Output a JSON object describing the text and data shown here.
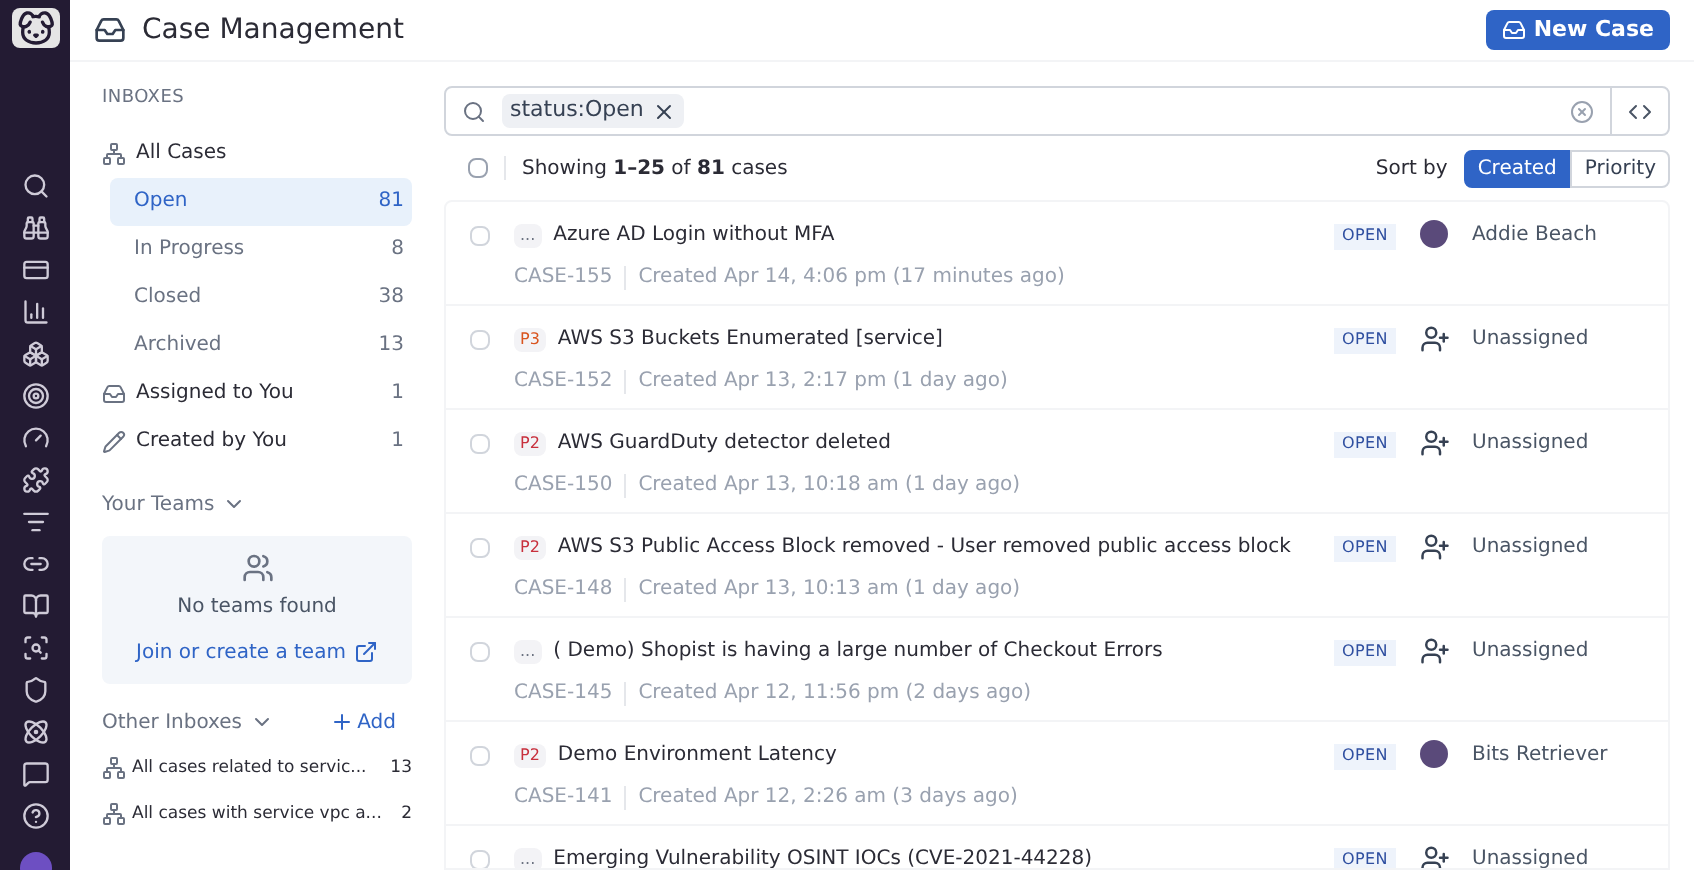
{
  "header": {
    "title": "Case Management",
    "new_button": "New Case"
  },
  "sidebar": {
    "inboxes_heading": "INBOXES",
    "items": [
      {
        "label": "All Cases",
        "kind": "cases",
        "selected": false,
        "children": [
          {
            "label": "Open",
            "count": "81",
            "selected": true
          },
          {
            "label": "In Progress",
            "count": "8",
            "selected": false
          },
          {
            "label": "Closed",
            "count": "38",
            "selected": false
          },
          {
            "label": "Archived",
            "count": "13",
            "selected": false
          }
        ]
      },
      {
        "label": "Assigned to You",
        "kind": "inbox",
        "count": "1",
        "selected": false
      },
      {
        "label": "Created by You",
        "kind": "pencil",
        "count": "1",
        "selected": false
      }
    ],
    "teams_heading": "Your Teams",
    "teams_empty": "No teams found",
    "teams_link": "Join or create a team",
    "other_heading": "Other Inboxes",
    "add_label": "Add",
    "other_items": [
      {
        "label": "All cases related to servic...",
        "count": "13"
      },
      {
        "label": "All cases with service vpc a...",
        "count": "2"
      }
    ]
  },
  "search": {
    "tag": "status:Open"
  },
  "list_header": {
    "select_all_checked": false,
    "showing": "Showing **1–25** of **81** cases",
    "sort_label": "Sort by",
    "sort_options": [
      {
        "label": "Created",
        "selected": true
      },
      {
        "label": "Priority",
        "selected": false
      }
    ]
  },
  "cases": [
    {
      "checked": false,
      "priority": {
        "label": "...",
        "color": "#6b7280"
      },
      "title": "Azure AD Login without MFA",
      "id": "CASE-155",
      "created": "Created Apr 14, 4:06 pm (17 minutes ago)",
      "status": "OPEN",
      "assignee": "Addie Beach",
      "kind": "assigned"
    },
    {
      "checked": false,
      "priority": {
        "label": "P3",
        "color": "#d9541e"
      },
      "title": "AWS S3 Buckets Enumerated [service]",
      "id": "CASE-152",
      "created": "Created Apr 13, 2:17 pm (1 day ago)",
      "status": "OPEN",
      "assignee": "Unassigned",
      "kind": "unassigned"
    },
    {
      "checked": false,
      "priority": {
        "label": "P2",
        "color": "#c8303d"
      },
      "title": "AWS GuardDuty detector deleted",
      "id": "CASE-150",
      "created": "Created Apr 13, 10:18 am (1 day ago)",
      "status": "OPEN",
      "assignee": "Unassigned",
      "kind": "unassigned"
    },
    {
      "checked": false,
      "priority": {
        "label": "P2",
        "color": "#c8303d"
      },
      "title": "AWS S3 Public Access Block removed - User removed public access block",
      "id": "CASE-148",
      "created": "Created Apr 13, 10:13 am (1 day ago)",
      "status": "OPEN",
      "assignee": "Unassigned",
      "kind": "unassigned"
    },
    {
      "checked": false,
      "priority": {
        "label": "...",
        "color": "#6b7280"
      },
      "title": "( Demo) Shopist is having a large number of Checkout Errors",
      "id": "CASE-145",
      "created": "Created Apr 12, 11:56 pm (2 days ago)",
      "status": "OPEN",
      "assignee": "Unassigned",
      "kind": "unassigned"
    },
    {
      "checked": false,
      "priority": {
        "label": "P2",
        "color": "#c8303d"
      },
      "title": "Demo Environment Latency",
      "id": "CASE-141",
      "created": "Created Apr 12, 2:26 am (3 days ago)",
      "status": "OPEN",
      "assignee": "Bits Retriever",
      "kind": "assigned"
    },
    {
      "checked": false,
      "priority": {
        "label": "...",
        "color": "#6b7280"
      },
      "title": "Emerging Vulnerability OSINT IOCs (CVE-2021-44228)",
      "status": "OPEN",
      "assignee": "Unassigned",
      "kind": "unassigned"
    }
  ]
}
